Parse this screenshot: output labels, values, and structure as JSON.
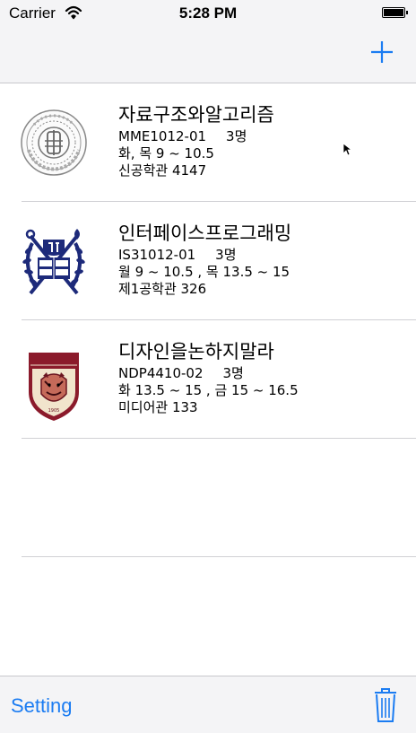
{
  "status_bar": {
    "carrier": "Carrier",
    "time": "5:28 PM"
  },
  "nav": {
    "add_icon": "plus-icon"
  },
  "courses": [
    {
      "name": "자료구조와알고리즘",
      "code": "MME1012-01",
      "credits": "3명",
      "schedule": "화, 목 9 ~ 10.5",
      "room": "신공학관 4147",
      "logo": "dongguk-university-seal"
    },
    {
      "name": "인터페이스프로그래밍",
      "code": "IS31012-01",
      "credits": "3명",
      "schedule": "월 9 ~ 10.5 , 목 13.5 ~ 15",
      "room": "제1공학관 326",
      "logo": "seoul-national-university-emblem"
    },
    {
      "name": "디자인을논하지말라",
      "code": "NDP4410-02",
      "credits": "3명",
      "schedule": "화 13.5 ~ 15 , 금 15 ~ 16.5",
      "room": "미디어관 133",
      "logo": "korea-university-crest"
    }
  ],
  "toolbar": {
    "setting_label": "Setting",
    "trash_icon": "trash-icon"
  },
  "colors": {
    "tint": "#1b7cf2",
    "bar_background": "#f4f4f6",
    "separator": "#d0d0d4"
  }
}
